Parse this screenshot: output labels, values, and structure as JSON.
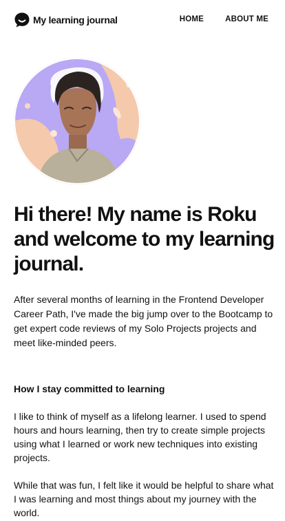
{
  "header": {
    "logo_text": "My learning journal",
    "logo_icon": "chat-bubble-smile-icon",
    "nav": [
      {
        "label": "HOME"
      },
      {
        "label": "ABOUT ME"
      }
    ]
  },
  "avatar": {
    "icon": "profile-photo",
    "colors": {
      "lavender": "#b9a8f4",
      "peach": "#f5c9ab",
      "skin": "#a87457",
      "hair": "#2b231f",
      "shirt": "#b8b09a"
    }
  },
  "hero": {
    "title": "Hi there! My name is Roku and welcome to my learning journal.",
    "intro": "After several months of learning in the Frontend Developer Career Path, I've made the big jump over to the Bootcamp to get expert code reviews of my Solo Projects projects and meet like-minded peers."
  },
  "section": {
    "heading": "How I stay committed to learning",
    "paragraphs": [
      "I like to think of myself as a lifelong learner. I used to spend hours and hours learning, then try to create simple projects using what I learned or work new techniques into existing projects.",
      "While that was fun, I felt like it would be helpful to share what I was learning and most things about my journey with the world."
    ]
  }
}
